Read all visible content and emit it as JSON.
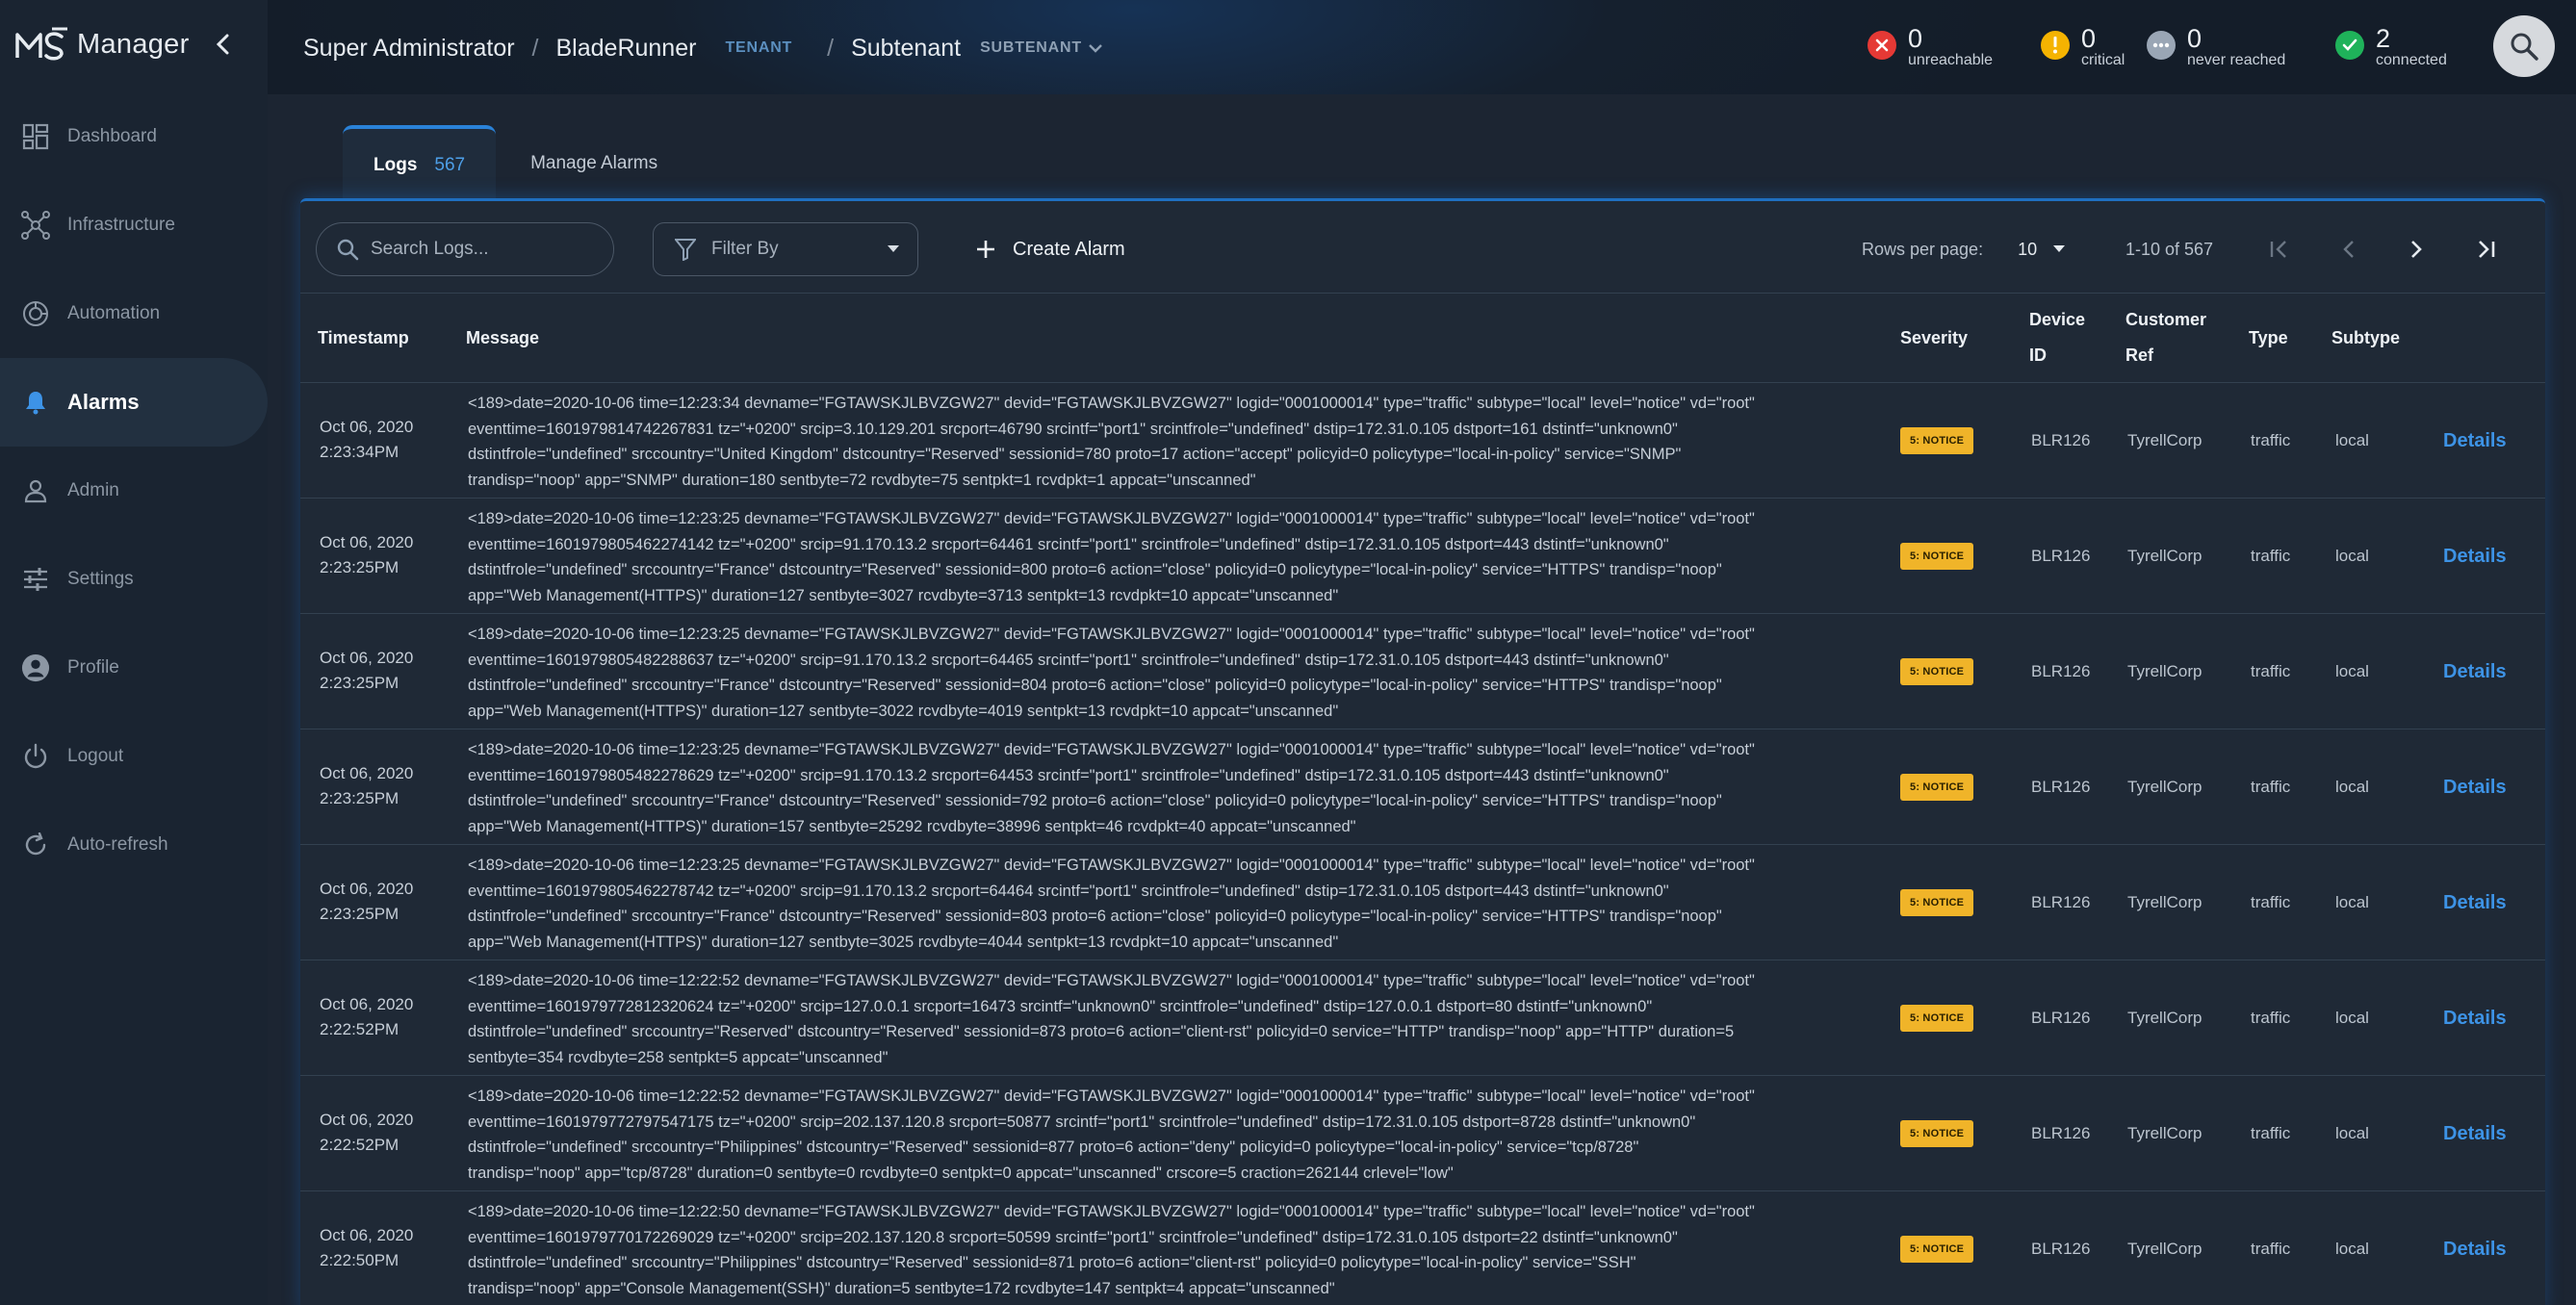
{
  "brand": {
    "name": "Manager"
  },
  "sidebar": {
    "items": [
      {
        "label": "Dashboard",
        "icon": "dashboard-icon"
      },
      {
        "label": "Infrastructure",
        "icon": "network-icon"
      },
      {
        "label": "Automation",
        "icon": "automation-icon"
      },
      {
        "label": "Alarms",
        "icon": "bell-icon",
        "active": true
      },
      {
        "label": "Admin",
        "icon": "person-icon"
      },
      {
        "label": "Settings",
        "icon": "sliders-icon"
      },
      {
        "label": "Profile",
        "icon": "profile-circle-icon"
      },
      {
        "label": "Logout",
        "icon": "power-icon"
      },
      {
        "label": "Auto-refresh",
        "icon": "refresh-icon"
      }
    ]
  },
  "header": {
    "crumb_root": "Super Administrator",
    "crumb_tenant": "BladeRunner",
    "crumb_tenant_tag": "TENANT",
    "crumb_subtenant": "Subtenant",
    "crumb_subtenant_tag": "SUBTENANT",
    "status": {
      "unreachable": {
        "count": "0",
        "label": "unreachable",
        "color": "#e53935"
      },
      "critical": {
        "count": "0",
        "label": "critical",
        "color": "#f5b301"
      },
      "never_reached": {
        "count": "0",
        "label": "never reached",
        "color": "#9aa6b5"
      },
      "connected": {
        "count": "2",
        "label": "connected",
        "color": "#1fb25a"
      }
    }
  },
  "tabs": {
    "logs_label": "Logs",
    "logs_count": "567",
    "manage_label": "Manage Alarms"
  },
  "toolbar": {
    "search_placeholder": "Search Logs...",
    "filter_label": "Filter By",
    "create_alarm_label": "Create Alarm",
    "rows_per_page_label": "Rows per page:",
    "rows_per_page_value": "10",
    "range_text": "1-10 of 567"
  },
  "table": {
    "headers": {
      "timestamp": "Timestamp",
      "message": "Message",
      "severity": "Severity",
      "device_id_1": "Device",
      "device_id_2": "ID",
      "customer_ref_1": "Customer",
      "customer_ref_2": "Ref",
      "type": "Type",
      "subtype": "Subtype"
    },
    "details_label": "Details",
    "rows": [
      {
        "date": "Oct 06, 2020",
        "time": "2:23:34PM",
        "msg": [
          "<189>date=2020-10-06 time=12:23:34 devname=\"FGTAWSKJLBVZGW27\" devid=\"FGTAWSKJLBVZGW27\" logid=\"0001000014\" type=\"traffic\" subtype=\"local\" level=\"notice\" vd=\"root\"",
          "eventtime=1601979814742267831 tz=\"+0200\" srcip=3.10.129.201 srcport=46790 srcintf=\"port1\" srcintfrole=\"undefined\" dstip=172.31.0.105 dstport=161 dstintf=\"unknown0\"",
          "dstintfrole=\"undefined\" srccountry=\"United Kingdom\" dstcountry=\"Reserved\" sessionid=780 proto=17 action=\"accept\" policyid=0 policytype=\"local-in-policy\" service=\"SNMP\"",
          "trandisp=\"noop\" app=\"SNMP\" duration=180 sentbyte=72 rcvdbyte=75 sentpkt=1 rcvdpkt=1 appcat=\"unscanned\""
        ],
        "severity": "5: NOTICE",
        "device": "BLR126",
        "customer": "TyrellCorp",
        "type": "traffic",
        "subtype": "local"
      },
      {
        "date": "Oct 06, 2020",
        "time": "2:23:25PM",
        "msg": [
          "<189>date=2020-10-06 time=12:23:25 devname=\"FGTAWSKJLBVZGW27\" devid=\"FGTAWSKJLBVZGW27\" logid=\"0001000014\" type=\"traffic\" subtype=\"local\" level=\"notice\" vd=\"root\"",
          "eventtime=1601979805462274142 tz=\"+0200\" srcip=91.170.13.2 srcport=64461 srcintf=\"port1\" srcintfrole=\"undefined\" dstip=172.31.0.105 dstport=443 dstintf=\"unknown0\"",
          "dstintfrole=\"undefined\" srccountry=\"France\" dstcountry=\"Reserved\" sessionid=800 proto=6 action=\"close\" policyid=0 policytype=\"local-in-policy\" service=\"HTTPS\" trandisp=\"noop\"",
          "app=\"Web Management(HTTPS)\" duration=127 sentbyte=3027 rcvdbyte=3713 sentpkt=13 rcvdpkt=10 appcat=\"unscanned\""
        ],
        "severity": "5: NOTICE",
        "device": "BLR126",
        "customer": "TyrellCorp",
        "type": "traffic",
        "subtype": "local"
      },
      {
        "date": "Oct 06, 2020",
        "time": "2:23:25PM",
        "msg": [
          "<189>date=2020-10-06 time=12:23:25 devname=\"FGTAWSKJLBVZGW27\" devid=\"FGTAWSKJLBVZGW27\" logid=\"0001000014\" type=\"traffic\" subtype=\"local\" level=\"notice\" vd=\"root\"",
          "eventtime=1601979805482288637 tz=\"+0200\" srcip=91.170.13.2 srcport=64465 srcintf=\"port1\" srcintfrole=\"undefined\" dstip=172.31.0.105 dstport=443 dstintf=\"unknown0\"",
          "dstintfrole=\"undefined\" srccountry=\"France\" dstcountry=\"Reserved\" sessionid=804 proto=6 action=\"close\" policyid=0 policytype=\"local-in-policy\" service=\"HTTPS\" trandisp=\"noop\"",
          "app=\"Web Management(HTTPS)\" duration=127 sentbyte=3022 rcvdbyte=4019 sentpkt=13 rcvdpkt=10 appcat=\"unscanned\""
        ],
        "severity": "5: NOTICE",
        "device": "BLR126",
        "customer": "TyrellCorp",
        "type": "traffic",
        "subtype": "local"
      },
      {
        "date": "Oct 06, 2020",
        "time": "2:23:25PM",
        "msg": [
          "<189>date=2020-10-06 time=12:23:25 devname=\"FGTAWSKJLBVZGW27\" devid=\"FGTAWSKJLBVZGW27\" logid=\"0001000014\" type=\"traffic\" subtype=\"local\" level=\"notice\" vd=\"root\"",
          "eventtime=1601979805482278629 tz=\"+0200\" srcip=91.170.13.2 srcport=64453 srcintf=\"port1\" srcintfrole=\"undefined\" dstip=172.31.0.105 dstport=443 dstintf=\"unknown0\"",
          "dstintfrole=\"undefined\" srccountry=\"France\" dstcountry=\"Reserved\" sessionid=792 proto=6 action=\"close\" policyid=0 policytype=\"local-in-policy\" service=\"HTTPS\" trandisp=\"noop\"",
          "app=\"Web Management(HTTPS)\" duration=157 sentbyte=25292 rcvdbyte=38996 sentpkt=46 rcvdpkt=40 appcat=\"unscanned\""
        ],
        "severity": "5: NOTICE",
        "device": "BLR126",
        "customer": "TyrellCorp",
        "type": "traffic",
        "subtype": "local"
      },
      {
        "date": "Oct 06, 2020",
        "time": "2:23:25PM",
        "msg": [
          "<189>date=2020-10-06 time=12:23:25 devname=\"FGTAWSKJLBVZGW27\" devid=\"FGTAWSKJLBVZGW27\" logid=\"0001000014\" type=\"traffic\" subtype=\"local\" level=\"notice\" vd=\"root\"",
          "eventtime=1601979805462278742 tz=\"+0200\" srcip=91.170.13.2 srcport=64464 srcintf=\"port1\" srcintfrole=\"undefined\" dstip=172.31.0.105 dstport=443 dstintf=\"unknown0\"",
          "dstintfrole=\"undefined\" srccountry=\"France\" dstcountry=\"Reserved\" sessionid=803 proto=6 action=\"close\" policyid=0 policytype=\"local-in-policy\" service=\"HTTPS\" trandisp=\"noop\"",
          "app=\"Web Management(HTTPS)\" duration=127 sentbyte=3025 rcvdbyte=4044 sentpkt=13 rcvdpkt=10 appcat=\"unscanned\""
        ],
        "severity": "5: NOTICE",
        "device": "BLR126",
        "customer": "TyrellCorp",
        "type": "traffic",
        "subtype": "local"
      },
      {
        "date": "Oct 06, 2020",
        "time": "2:22:52PM",
        "msg": [
          "<189>date=2020-10-06 time=12:22:52 devname=\"FGTAWSKJLBVZGW27\" devid=\"FGTAWSKJLBVZGW27\" logid=\"0001000014\" type=\"traffic\" subtype=\"local\" level=\"notice\" vd=\"root\"",
          "eventtime=1601979772812320624 tz=\"+0200\" srcip=127.0.0.1 srcport=16473 srcintf=\"unknown0\" srcintfrole=\"undefined\" dstip=127.0.0.1 dstport=80 dstintf=\"unknown0\"",
          "dstintfrole=\"undefined\" srccountry=\"Reserved\" dstcountry=\"Reserved\" sessionid=873 proto=6 action=\"client-rst\" policyid=0 service=\"HTTP\" trandisp=\"noop\" app=\"HTTP\" duration=5",
          "sentbyte=354 rcvdbyte=258 sentpkt=5 appcat=\"unscanned\""
        ],
        "severity": "5: NOTICE",
        "device": "BLR126",
        "customer": "TyrellCorp",
        "type": "traffic",
        "subtype": "local"
      },
      {
        "date": "Oct 06, 2020",
        "time": "2:22:52PM",
        "msg": [
          "<189>date=2020-10-06 time=12:22:52 devname=\"FGTAWSKJLBVZGW27\" devid=\"FGTAWSKJLBVZGW27\" logid=\"0001000014\" type=\"traffic\" subtype=\"local\" level=\"notice\" vd=\"root\"",
          "eventtime=1601979772797547175 tz=\"+0200\" srcip=202.137.120.8 srcport=50877 srcintf=\"port1\" srcintfrole=\"undefined\" dstip=172.31.0.105 dstport=8728 dstintf=\"unknown0\"",
          "dstintfrole=\"undefined\" srccountry=\"Philippines\" dstcountry=\"Reserved\" sessionid=877 proto=6 action=\"deny\" policyid=0 policytype=\"local-in-policy\" service=\"tcp/8728\"",
          "trandisp=\"noop\" app=\"tcp/8728\" duration=0 sentbyte=0 rcvdbyte=0 sentpkt=0 appcat=\"unscanned\" crscore=5 craction=262144 crlevel=\"low\""
        ],
        "severity": "5: NOTICE",
        "device": "BLR126",
        "customer": "TyrellCorp",
        "type": "traffic",
        "subtype": "local"
      },
      {
        "date": "Oct 06, 2020",
        "time": "2:22:50PM",
        "msg": [
          "<189>date=2020-10-06 time=12:22:50 devname=\"FGTAWSKJLBVZGW27\" devid=\"FGTAWSKJLBVZGW27\" logid=\"0001000014\" type=\"traffic\" subtype=\"local\" level=\"notice\" vd=\"root\"",
          "eventtime=1601979770172269029 tz=\"+0200\" srcip=202.137.120.8 srcport=50599 srcintf=\"port1\" srcintfrole=\"undefined\" dstip=172.31.0.105 dstport=22 dstintf=\"unknown0\"",
          "dstintfrole=\"undefined\" srccountry=\"Philippines\" dstcountry=\"Reserved\" sessionid=871 proto=6 action=\"client-rst\" policyid=0 policytype=\"local-in-policy\" service=\"SSH\"",
          "trandisp=\"noop\" app=\"Console Management(SSH)\" duration=5 sentbyte=172 rcvdbyte=147 sentpkt=4 appcat=\"unscanned\""
        ],
        "severity": "5: NOTICE",
        "device": "BLR126",
        "customer": "TyrellCorp",
        "type": "traffic",
        "subtype": "local"
      }
    ]
  }
}
